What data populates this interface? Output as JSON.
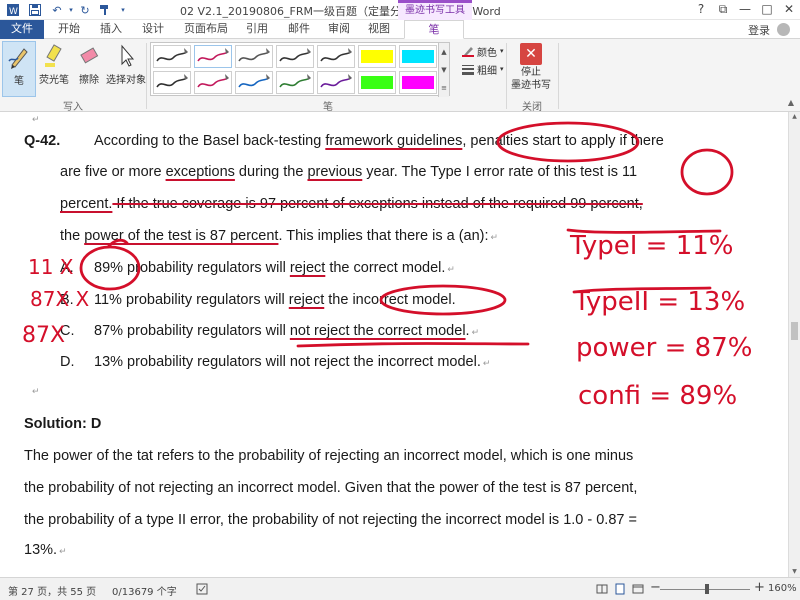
{
  "titlebar": {
    "title": "02 V2.1_20190806_FRM一级百题（定量分析）_授课版 - Word",
    "context_tab": "墨迹书写工具",
    "minimize": "—",
    "maximize": "□",
    "close": "✕",
    "help": "?",
    "ribbon_display": "⧉"
  },
  "tabs": {
    "file": "文件",
    "home": "开始",
    "insert": "插入",
    "design": "设计",
    "layout": "页面布局",
    "references": "引用",
    "mailings": "邮件",
    "review": "审阅",
    "view": "视图",
    "pen": "笔",
    "login": "登录"
  },
  "ribbon": {
    "write_group": {
      "pen": "笔",
      "highlighter": "荧光笔",
      "eraser": "擦除",
      "select_objects": "选择对象",
      "label": "写入"
    },
    "pens_group": {
      "label": "笔",
      "swatches": [
        {
          "color": "#333333",
          "kind": "pen"
        },
        {
          "color": "#c2185b",
          "kind": "pen"
        },
        {
          "color": "#555555",
          "kind": "pen"
        },
        {
          "color": "#333333",
          "kind": "pen"
        },
        {
          "color": "#333333",
          "kind": "pen"
        },
        {
          "color": "#ffff00",
          "kind": "highlighter"
        },
        {
          "color": "#00e5ff",
          "kind": "highlighter"
        },
        {
          "color": "#2e2e2e",
          "kind": "pen"
        },
        {
          "color": "#c2185b",
          "kind": "pen"
        },
        {
          "color": "#1565c0",
          "kind": "pen"
        },
        {
          "color": "#2e7d32",
          "kind": "pen"
        },
        {
          "color": "#6a1b9a",
          "kind": "pen"
        },
        {
          "color": "#39ff14",
          "kind": "highlighter"
        },
        {
          "color": "#ff00ff",
          "kind": "highlighter"
        }
      ],
      "color": "颜色",
      "thickness": "粗细"
    },
    "close_group": {
      "stop_inking_line1": "停止",
      "stop_inking_line2": "墨迹书写",
      "label": "关闭"
    }
  },
  "document": {
    "question_id": "Q-42.",
    "q_line1_a": "According to the Basel back-testing ",
    "q_line1_b": "framework guidelines",
    "q_line1_c": ", penalties start to apply if there",
    "q_line2_a": "are five or more ",
    "q_line2_b": "exceptions",
    "q_line2_c": " during the ",
    "q_line2_d": "previous",
    "q_line2_e": " year. The Type I error rate of this test is 11",
    "q_line3_a": "percent.",
    "q_line3_b": " If the true coverage is 97 percent of exceptions instead of the required 99 percent,",
    "q_line4_a": "the ",
    "q_line4_b": "power of the test is 87 percent",
    "q_line4_c": ". This implies that there is a (an):",
    "opt_a_letter": "A.",
    "opt_a_1": "89% probability regulators will ",
    "opt_a_2": "reject",
    "opt_a_3": " the correct model.",
    "opt_b_letter": "B.",
    "opt_b_1": "11% probability regulators will ",
    "opt_b_2": "reject",
    "opt_b_3": " the incorrect model",
    "opt_b_4": ".",
    "opt_c_letter": "C.",
    "opt_c_1": "87% probability regulators will ",
    "opt_c_2": "not reject the correct model",
    "opt_c_3": ".",
    "opt_d_letter": "D.",
    "opt_d_text": "13% probability regulators will not reject the incorrect model.",
    "solution_label": "Solution: D",
    "sol_line1": "The power of the tat refers to the probability of rejecting an incorrect model, which is one minus",
    "sol_line2": "the probability of not rejecting an incorrect model. Given that the power of the test is 87 percent,",
    "sol_line3": "the probability of a type II error, the probability of not rejecting the incorrect model is 1.0 - 0.87 =",
    "sol_line4": "13%."
  },
  "ink": {
    "n_11x": "11 X",
    "n_87x_b": "87X X",
    "n_87x_c": "87X",
    "hw_type1": "TypeI = 11%",
    "hw_type2": "TypeII = 13%",
    "hw_power": "power = 87%",
    "hw_confi": "confi = 89%",
    "color": "#d40f2a"
  },
  "status": {
    "page": "第 27 页，共 55 页",
    "words": "0/13679 个字",
    "zoom": "160%",
    "zoom_minus": "−",
    "zoom_plus": "+"
  }
}
